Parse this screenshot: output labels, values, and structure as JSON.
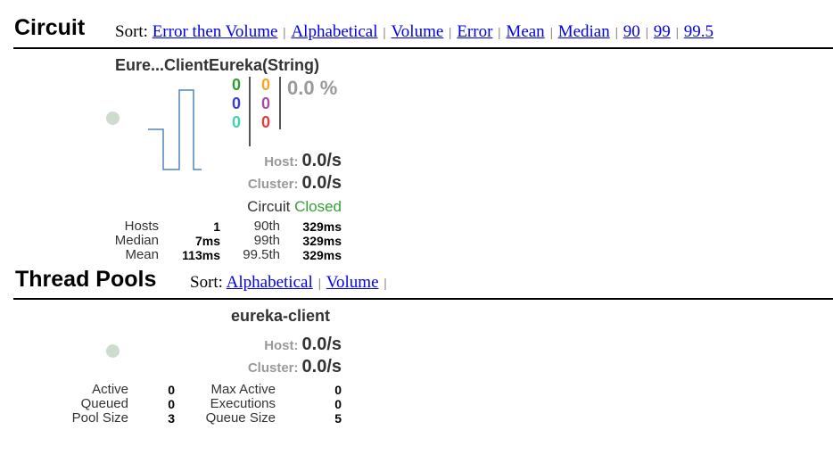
{
  "circuit": {
    "section_title": "Circuit",
    "sort_label": "Sort:",
    "sort_options": [
      "Error then Volume",
      "Alphabetical",
      "Volume",
      "Error",
      "Mean",
      "Median",
      "90",
      "99",
      "99.5"
    ],
    "card": {
      "title": "Eure...ClientEureka(String)",
      "counts_col1": [
        "0",
        "0",
        "0"
      ],
      "counts_col2": [
        "0",
        "0",
        "0"
      ],
      "colors": {
        "success": "#2f9e2f",
        "short_circuited": "#3b3bdb",
        "bad_request": "#3fd3b0",
        "timeout": "#f5a623",
        "rejected": "#a64ca6",
        "failure": "#e03e3e",
        "sparkline": "#4f86b8",
        "closed": "#34a134"
      },
      "error_pct": "0.0 %",
      "host_label": "Host:",
      "host_rate": "0.0/s",
      "cluster_label": "Cluster:",
      "cluster_rate": "0.0/s",
      "circuit_label": "Circuit",
      "circuit_state": "Closed",
      "stats_left_labels": [
        "Hosts",
        "Median",
        "Mean"
      ],
      "stats_left_values": [
        "1",
        "7ms",
        "113ms"
      ],
      "stats_right_labels": [
        "90th",
        "99th",
        "99.5th"
      ],
      "stats_right_values": [
        "329ms",
        "329ms",
        "329ms"
      ]
    }
  },
  "thread_pools": {
    "section_title": "Thread Pools",
    "sort_label": "Sort:",
    "sort_options": [
      "Alphabetical",
      "Volume"
    ],
    "card": {
      "title": "eureka-client",
      "host_label": "Host:",
      "host_rate": "0.0/s",
      "cluster_label": "Cluster:",
      "cluster_rate": "0.0/s",
      "stats_left_labels": [
        "Active",
        "Queued",
        "Pool Size"
      ],
      "stats_left_values": [
        "0",
        "0",
        "3"
      ],
      "stats_right_labels": [
        "Max Active",
        "Executions",
        "Queue Size"
      ],
      "stats_right_values": [
        "0",
        "0",
        "5"
      ]
    }
  }
}
